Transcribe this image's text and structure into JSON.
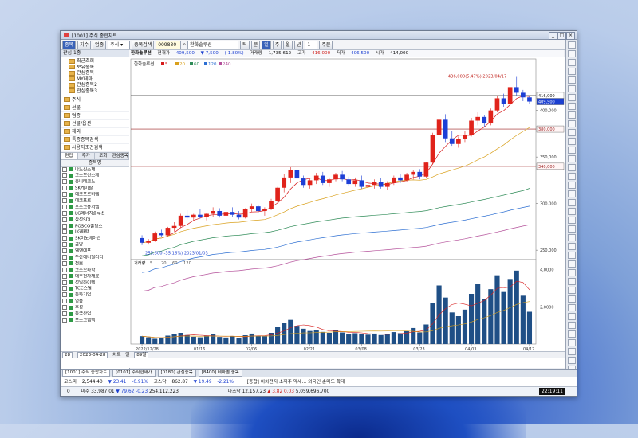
{
  "window": {
    "title": "[1001] 주식 종합차트",
    "controls": [
      "_",
      "□",
      "×"
    ]
  },
  "toolbar": {
    "tabs": [
      "종목",
      "지수",
      "업종"
    ],
    "market": "주식",
    "search_label": "종목검색",
    "code": "009830",
    "name": "한화솔루션",
    "period_buttons": [
      "틱",
      "분",
      "일",
      "주",
      "월",
      "년"
    ],
    "interval": "1",
    "order_button": "주문"
  },
  "left_panel": {
    "tree_header": "관심 1종",
    "tree_items": [
      "최근조회",
      "보유종목",
      "관심종목",
      "MY테마",
      "관심종목2",
      "관심종목3"
    ],
    "categories": [
      "주식",
      "선물",
      "업종",
      "선물/옵션",
      "해외",
      "특종종목검색",
      "사용자조건검색"
    ],
    "subtabs": [
      "편집",
      "추가",
      "조회",
      "관심종목"
    ],
    "list_header": "종목명",
    "stocks": [
      "나노신소재",
      "코스모신소재",
      "유니테크노",
      "SK케미칼",
      "에코프로비엠",
      "에코프로",
      "포스코퓨처엠",
      "LG에너지솔루션",
      "삼성SDI",
      "POSCO홀딩스",
      "LG화학",
      "SK이노베이션",
      "금양",
      "엘앤에프",
      "두산에너빌리티",
      "천보",
      "코스모화학",
      "대주전자재료",
      "성일하이텍",
      "TCC스틸",
      "동화기업",
      "영풍",
      "후성",
      "동국산업",
      "포스코엠텍"
    ]
  },
  "info_bar": {
    "name": "한화솔루션",
    "last_label": "현재가",
    "last": "409,500",
    "change": "▼ 7,500",
    "change_pct": "(-1.80%)",
    "volume_label": "거래량",
    "volume": "1,735,612",
    "high_label": "고가",
    "high": "416,000",
    "low_label": "저가",
    "low": "406,500",
    "open_label": "시가",
    "open": "414,000"
  },
  "chart_data": {
    "type": "candlestick",
    "title": "한화솔루션",
    "legend": [
      {
        "name": "5",
        "color": "#d61a1a"
      },
      {
        "name": "20",
        "color": "#d9a01c"
      },
      {
        "name": "60",
        "color": "#2e8b57"
      },
      {
        "name": "120",
        "color": "#2d6fd2"
      },
      {
        "name": "240",
        "color": "#b4509a"
      }
    ],
    "ylim": [
      245000,
      445000
    ],
    "y_ticks": [
      250000,
      300000,
      350000,
      400000
    ],
    "x_ticks": [
      "2022/12/28",
      "01/16",
      "02/06",
      "02/21",
      "03/08",
      "03/23",
      "04/03",
      "04/17"
    ],
    "annotations": {
      "max": "436,000(5.47%) 2023/04/17",
      "min": "255,500(-35.16%) 2023/01/03",
      "hlines": [
        416000,
        409500,
        380000,
        340000
      ]
    },
    "candles": [
      {
        "o": 263000,
        "h": 266000,
        "l": 255500,
        "c": 258000
      },
      {
        "o": 258000,
        "h": 262000,
        "l": 256000,
        "c": 260000
      },
      {
        "o": 260000,
        "h": 270000,
        "l": 259000,
        "c": 268000
      },
      {
        "o": 268000,
        "h": 272000,
        "l": 264000,
        "c": 266000
      },
      {
        "o": 266000,
        "h": 275000,
        "l": 265000,
        "c": 274000
      },
      {
        "o": 274000,
        "h": 280000,
        "l": 270000,
        "c": 276000
      },
      {
        "o": 276000,
        "h": 289000,
        "l": 274000,
        "c": 287000
      },
      {
        "o": 287000,
        "h": 293000,
        "l": 283000,
        "c": 285000
      },
      {
        "o": 285000,
        "h": 289000,
        "l": 281000,
        "c": 288000
      },
      {
        "o": 288000,
        "h": 294000,
        "l": 284000,
        "c": 286000
      },
      {
        "o": 286000,
        "h": 290000,
        "l": 282000,
        "c": 289000
      },
      {
        "o": 289000,
        "h": 296000,
        "l": 286000,
        "c": 292000
      },
      {
        "o": 292000,
        "h": 295000,
        "l": 285000,
        "c": 287000
      },
      {
        "o": 287000,
        "h": 293000,
        "l": 284000,
        "c": 291000
      },
      {
        "o": 291000,
        "h": 296000,
        "l": 286000,
        "c": 288000
      },
      {
        "o": 288000,
        "h": 292000,
        "l": 283000,
        "c": 285000
      },
      {
        "o": 285000,
        "h": 295000,
        "l": 284000,
        "c": 294000
      },
      {
        "o": 294000,
        "h": 300000,
        "l": 291000,
        "c": 297000
      },
      {
        "o": 297000,
        "h": 299000,
        "l": 290000,
        "c": 292000
      },
      {
        "o": 292000,
        "h": 296000,
        "l": 287000,
        "c": 294000
      },
      {
        "o": 294000,
        "h": 305000,
        "l": 293000,
        "c": 303000
      },
      {
        "o": 303000,
        "h": 318000,
        "l": 301000,
        "c": 317000
      },
      {
        "o": 317000,
        "h": 332000,
        "l": 312000,
        "c": 328000
      },
      {
        "o": 328000,
        "h": 339000,
        "l": 322000,
        "c": 336000
      },
      {
        "o": 336000,
        "h": 338000,
        "l": 324000,
        "c": 327000
      },
      {
        "o": 327000,
        "h": 330000,
        "l": 317000,
        "c": 320000
      },
      {
        "o": 320000,
        "h": 327000,
        "l": 316000,
        "c": 325000
      },
      {
        "o": 325000,
        "h": 333000,
        "l": 321000,
        "c": 330000
      },
      {
        "o": 330000,
        "h": 334000,
        "l": 320000,
        "c": 322000
      },
      {
        "o": 322000,
        "h": 328000,
        "l": 318000,
        "c": 326000
      },
      {
        "o": 326000,
        "h": 333000,
        "l": 324000,
        "c": 331000
      },
      {
        "o": 331000,
        "h": 335000,
        "l": 324000,
        "c": 326000
      },
      {
        "o": 326000,
        "h": 329000,
        "l": 319000,
        "c": 321000
      },
      {
        "o": 321000,
        "h": 328000,
        "l": 318000,
        "c": 325000
      },
      {
        "o": 325000,
        "h": 330000,
        "l": 316000,
        "c": 318000
      },
      {
        "o": 318000,
        "h": 323000,
        "l": 314000,
        "c": 320000
      },
      {
        "o": 320000,
        "h": 326000,
        "l": 316000,
        "c": 323000
      },
      {
        "o": 323000,
        "h": 327000,
        "l": 316000,
        "c": 318000
      },
      {
        "o": 318000,
        "h": 324000,
        "l": 315000,
        "c": 322000
      },
      {
        "o": 322000,
        "h": 330000,
        "l": 320000,
        "c": 328000
      },
      {
        "o": 328000,
        "h": 332000,
        "l": 322000,
        "c": 325000
      },
      {
        "o": 325000,
        "h": 333000,
        "l": 323000,
        "c": 331000
      },
      {
        "o": 331000,
        "h": 336000,
        "l": 326000,
        "c": 334000
      },
      {
        "o": 334000,
        "h": 337000,
        "l": 326000,
        "c": 329000
      },
      {
        "o": 329000,
        "h": 345000,
        "l": 327000,
        "c": 344000
      },
      {
        "o": 344000,
        "h": 376000,
        "l": 342000,
        "c": 374000
      },
      {
        "o": 374000,
        "h": 393000,
        "l": 370000,
        "c": 390000
      },
      {
        "o": 390000,
        "h": 396000,
        "l": 366000,
        "c": 370000
      },
      {
        "o": 370000,
        "h": 378000,
        "l": 362000,
        "c": 364000
      },
      {
        "o": 364000,
        "h": 372000,
        "l": 360000,
        "c": 369000
      },
      {
        "o": 369000,
        "h": 378000,
        "l": 366000,
        "c": 374000
      },
      {
        "o": 374000,
        "h": 392000,
        "l": 372000,
        "c": 389000
      },
      {
        "o": 389000,
        "h": 398000,
        "l": 384000,
        "c": 393000
      },
      {
        "o": 393000,
        "h": 395000,
        "l": 382000,
        "c": 386000
      },
      {
        "o": 386000,
        "h": 402000,
        "l": 384000,
        "c": 400000
      },
      {
        "o": 400000,
        "h": 416000,
        "l": 398000,
        "c": 413000
      },
      {
        "o": 413000,
        "h": 418000,
        "l": 404000,
        "c": 407000
      },
      {
        "o": 407000,
        "h": 428000,
        "l": 405000,
        "c": 425000
      },
      {
        "o": 425000,
        "h": 436000,
        "l": 416000,
        "c": 419000
      },
      {
        "o": 419000,
        "h": 422000,
        "l": 410000,
        "c": 414000
      },
      {
        "o": 414000,
        "h": 416000,
        "l": 406500,
        "c": 409500
      }
    ],
    "volume": {
      "legend": [
        "거래량",
        "5",
        "20",
        "60",
        "120"
      ],
      "y_ticks": [
        "4,0000",
        "2,0000"
      ],
      "ymax": 4200000,
      "values": [
        420000,
        360000,
        280000,
        310000,
        450000,
        520000,
        600000,
        480000,
        390000,
        360000,
        440000,
        520000,
        380000,
        350000,
        410000,
        330000,
        470000,
        560000,
        440000,
        420000,
        600000,
        900000,
        1150000,
        1300000,
        980000,
        820000,
        700000,
        760000,
        650000,
        600000,
        740000,
        620000,
        540000,
        580000,
        520000,
        500000,
        560000,
        480000,
        520000,
        640000,
        580000,
        700000,
        860000,
        620000,
        1050000,
        2200000,
        3150000,
        2500000,
        1700000,
        1500000,
        1850000,
        2700000,
        3250000,
        2400000,
        2950000,
        3700000,
        2800000,
        3500000,
        3950000,
        2600000,
        1735612
      ]
    }
  },
  "chart_footer": {
    "scale": "28",
    "date_from": "2023-04-28",
    "label1": "차트",
    "label2": "일",
    "zoom": "89일"
  },
  "bottom_tabs": [
    "[1001] 주식 종합차트",
    "[0101] 주식현재가",
    "[0180] 관심종목",
    "[8400] 테마별 종목"
  ],
  "ticker": {
    "index1_name": "코스피",
    "index1_value": "2,544.40",
    "index1_change": "▼ 23.41",
    "index1_pct": "-0.91%",
    "index2_name": "코스닥",
    "index2_value": "862.87",
    "index2_change": "▼ 19.49",
    "index2_pct": "-2.21%",
    "news": "[종합] 이차전지 소재주 약세… 외국인 순매도 확대"
  },
  "ticker2": {
    "row_num": "0",
    "label": "미주",
    "value": "33,987.01",
    "change": "▼ 79.62",
    "pct": "-0.23",
    "volume": "254,112,223",
    "nasdaq_name": "나스닥",
    "nasdaq_value": "12,157.23",
    "nasdaq_change": "▲ 3.82",
    "nasdaq_pct": "0.03",
    "nasdaq_volume": "5,059,696,700",
    "clock": "22:19:11"
  }
}
